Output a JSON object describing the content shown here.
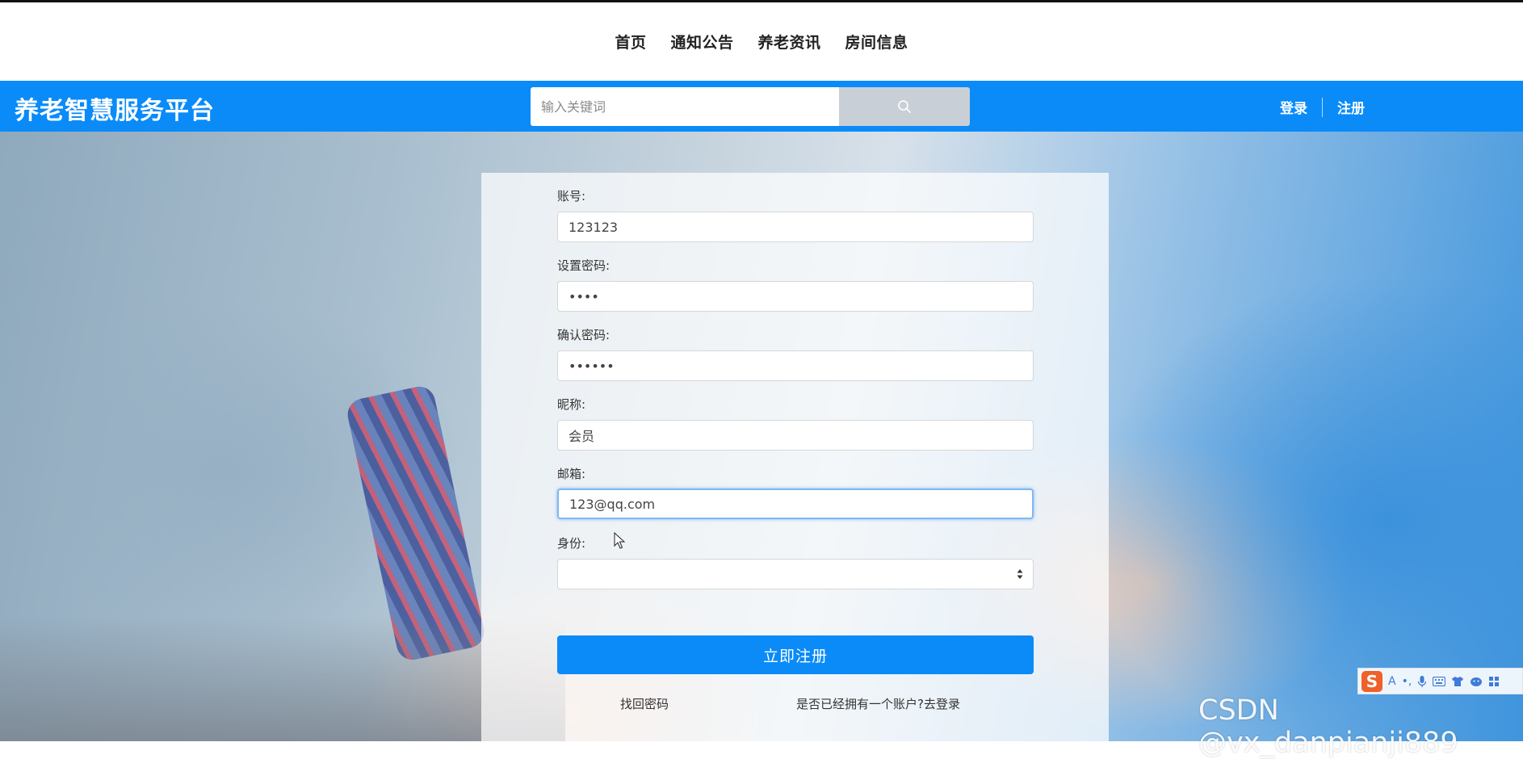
{
  "nav": {
    "items": [
      "首页",
      "通知公告",
      "养老资讯",
      "房间信息"
    ]
  },
  "header": {
    "brand": "养老智慧服务平台",
    "search_placeholder": "输入关键词",
    "search_icon": "search-icon",
    "login": "登录",
    "register": "注册"
  },
  "form": {
    "account_label": "账号:",
    "account_value": "123123",
    "password_label": "设置密码:",
    "password_value": "••••",
    "confirm_label": "确认密码:",
    "confirm_value": "••••••",
    "nickname_label": "昵称:",
    "nickname_value": "会员",
    "email_label": "邮箱:",
    "email_value": "123@qq.com",
    "identity_label": "身份:",
    "identity_value": "",
    "submit": "立即注册",
    "forgot": "找回密码",
    "have_account": "是否已经拥有一个账户?去登录"
  },
  "ime": {
    "logo": "S",
    "tools": [
      "A",
      "•,",
      "mic-icon",
      "keyboard-icon",
      "shirt-icon",
      "emoji-icon",
      "grid-icon"
    ]
  },
  "watermark": "CSDN @vx_danpianji889",
  "colors": {
    "primary": "#0a8bf8",
    "search_button": "#c9cfd6"
  }
}
